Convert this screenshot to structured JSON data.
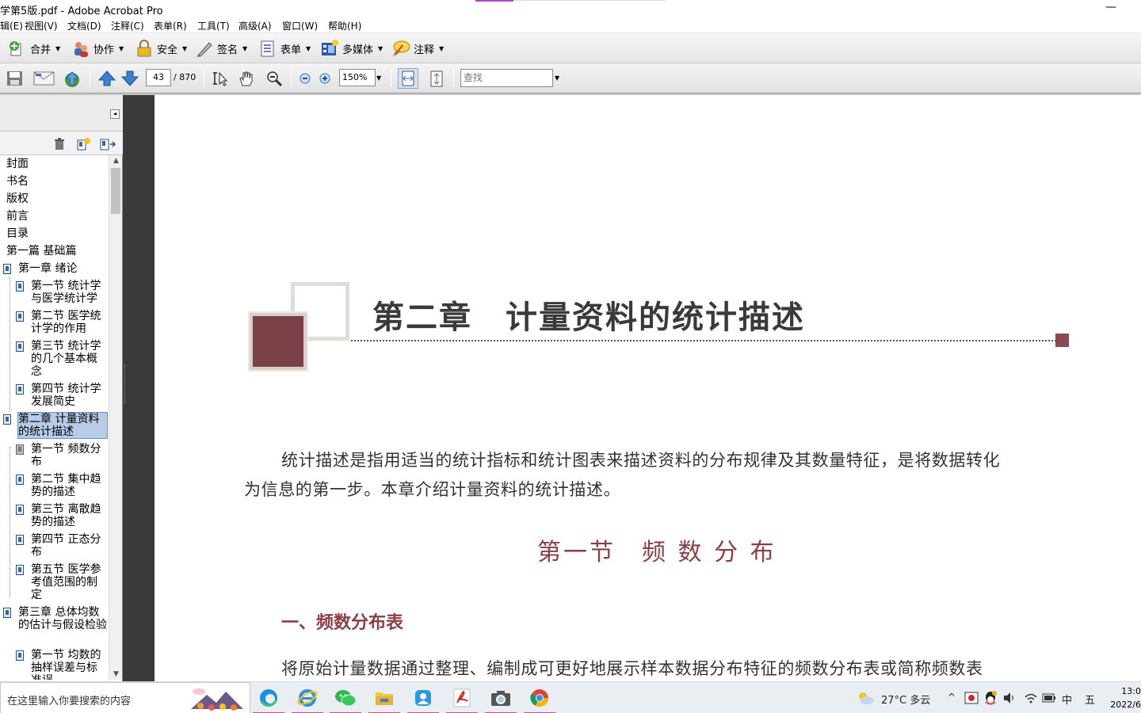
{
  "window": {
    "title": "学第5版.pdf - Adobe Acrobat Pro",
    "minimize": "—"
  },
  "menu": [
    "辑(E)",
    "视图(V)",
    "文档(D)",
    "注释(C)",
    "表单(R)",
    "工具(T)",
    "高级(A)",
    "窗口(W)",
    "帮助(H)"
  ],
  "toolbar": {
    "combine": "合并",
    "collaborate": "协作",
    "secure": "安全",
    "sign": "签名",
    "forms": "表单",
    "multimedia": "多媒体",
    "comment": "注释"
  },
  "nav": {
    "current_page": "43",
    "page_total": "/ 870",
    "zoom": "150%",
    "find_placeholder": "查找"
  },
  "bookmarks": [
    {
      "label": "封面"
    },
    {
      "label": "书名"
    },
    {
      "label": "版权"
    },
    {
      "label": "前言"
    },
    {
      "label": "目录"
    },
    {
      "label": "第一篇 基础篇"
    },
    {
      "label": "第一章 绪论"
    },
    {
      "label": "第一节 统计学与医学统计学"
    },
    {
      "label": "第二节 医学统计学的作用"
    },
    {
      "label": "第三节 统计学的几个基本概念"
    },
    {
      "label": "第四节 统计学发展简史"
    },
    {
      "label": "第二章 计量资料的统计描述",
      "selected": true
    },
    {
      "label": "第一节 频数分布"
    },
    {
      "label": "第二节 集中趋势的描述"
    },
    {
      "label": "第三节 离散趋势的描述"
    },
    {
      "label": "第四节 正态分布"
    },
    {
      "label": "第五节 医学参考值范围的制定"
    },
    {
      "label": "第三章 总体均数的估计与假设检验"
    },
    {
      "label": "第一节 均数的抽样误差与标准误"
    }
  ],
  "document": {
    "chapter_title": "第二章　计量资料的统计描述",
    "intro_line1": "统计描述是指用适当的统计指标和统计图表来描述资料的分布规律及其数量特征，是将数据转化",
    "intro_line2": "为信息的第一步。本章介绍计量资料的统计描述。",
    "section_title": "第一节　频 数 分 布",
    "subsection_title": "一、频数分布表",
    "body_line": "将原始计量数据通过整理、编制成可更好地展示样本数据分布特征的频数分布表或简称频数表"
  },
  "taskbar": {
    "search_placeholder": "在这里输入你要搜索的内容",
    "weather": "27°C 多云",
    "ime": "中",
    "ime2": "五",
    "time": "13:0",
    "date": "2022/6"
  },
  "colors": {
    "accent_red": "#8a3f47",
    "selection": "#b7cce8"
  }
}
